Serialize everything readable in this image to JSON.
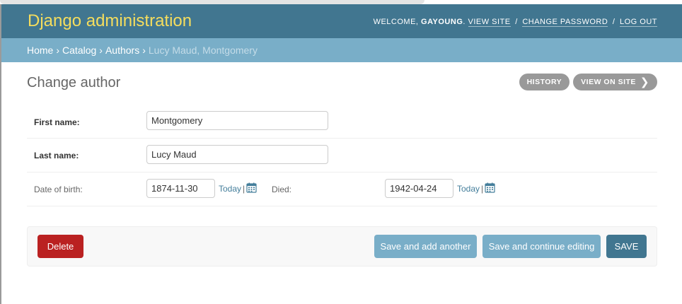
{
  "header": {
    "branding": "Django administration",
    "welcome": "Welcome,",
    "username": "gayoung",
    "view_site": "View site",
    "change_password": "Change password",
    "log_out": "Log out",
    "separator": "/"
  },
  "breadcrumbs": {
    "items": [
      "Home",
      "Catalog",
      "Authors"
    ],
    "current": "Lucy Maud, Montgomery",
    "arrow": "›"
  },
  "content": {
    "title": "Change author",
    "history_label": "History",
    "view_on_site_label": "View on site",
    "view_on_site_chevron": "❯"
  },
  "form": {
    "first_name": {
      "label": "First name:",
      "value": "Montgomery"
    },
    "last_name": {
      "label": "Last name:",
      "value": "Lucy Maud"
    },
    "date_of_birth": {
      "label": "Date of birth:",
      "value": "1874-11-30",
      "today": "Today",
      "bar": "|"
    },
    "died": {
      "label": "Died:",
      "value": "1942-04-24",
      "today": "Today",
      "bar": "|"
    }
  },
  "submit": {
    "delete": "Delete",
    "save_add_another": "Save and add another",
    "save_continue": "Save and continue editing",
    "save": "SAVE"
  },
  "colors": {
    "header_bg": "#417690",
    "branding": "#f5dd5d",
    "breadcrumbs_bg": "#79aec8",
    "delete_bg": "#ba2121",
    "link": "#447e9b"
  },
  "icons": {
    "calendar": "calendar-icon",
    "chevron": "chevron-right-icon"
  }
}
